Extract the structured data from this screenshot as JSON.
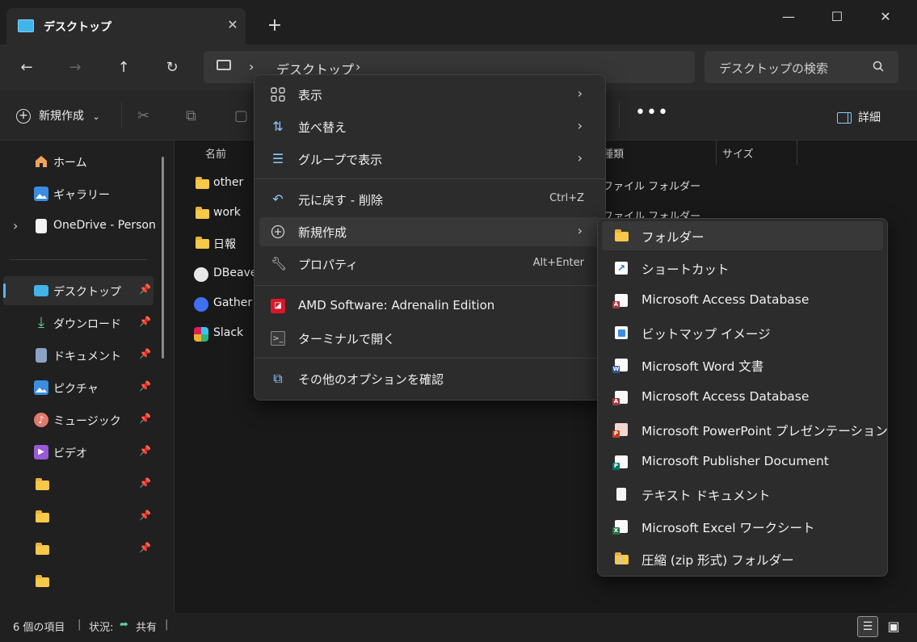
{
  "window": {
    "tab_title": "デスクトップ",
    "tab_close": "✕",
    "new_tab": "+",
    "minimize": "—",
    "maximize": "☐",
    "close": "✕"
  },
  "nav": {
    "back": "←",
    "forward": "→",
    "up": "↑",
    "refresh": "↻",
    "breadcrumb_sep": "›",
    "breadcrumb": "デスクトップ",
    "search_placeholder": "デスクトップの検索"
  },
  "toolbar": {
    "new_label": "新規作成",
    "new_dropdown": "⌄",
    "more": "•••",
    "details_label": "詳細"
  },
  "sidebar": {
    "items": [
      {
        "label": "ホーム",
        "icon": "home-icon",
        "pinned": false
      },
      {
        "label": "ギャラリー",
        "icon": "gallery-icon",
        "pinned": false
      },
      {
        "label": "OneDrive - Persona",
        "icon": "document-icon",
        "pinned": false,
        "expander": "›"
      },
      {
        "label": "デスクトップ",
        "icon": "desktop-icon",
        "pinned": true,
        "selected": true
      },
      {
        "label": "ダウンロード",
        "icon": "download-icon",
        "pinned": true
      },
      {
        "label": "ドキュメント",
        "icon": "documents-icon",
        "pinned": true
      },
      {
        "label": "ピクチャ",
        "icon": "pictures-icon",
        "pinned": true
      },
      {
        "label": "ミュージック",
        "icon": "music-icon",
        "pinned": true
      },
      {
        "label": "ビデオ",
        "icon": "video-icon",
        "pinned": true
      },
      {
        "label": "",
        "icon": "folder-icon",
        "pinned": true
      },
      {
        "label": "",
        "icon": "folder-icon",
        "pinned": true
      },
      {
        "label": "",
        "icon": "folder-icon",
        "pinned": true
      },
      {
        "label": "",
        "icon": "folder-icon",
        "pinned": false
      }
    ]
  },
  "content": {
    "columns": [
      "名前",
      "種類",
      "サイズ"
    ],
    "rows": [
      {
        "name": "other",
        "type": "ファイル フォルダー",
        "icon": "folder-icon"
      },
      {
        "name": "work",
        "type": "ファイル フォルダー",
        "icon": "folder-icon"
      },
      {
        "name": "日報",
        "type": "",
        "icon": "folder-icon"
      },
      {
        "name": "DBeave",
        "type": "",
        "icon": "shortcut-icon"
      },
      {
        "name": "Gather",
        "type": "",
        "icon": "shortcut-icon"
      },
      {
        "name": "Slack",
        "type": "",
        "icon": "slack-icon"
      }
    ]
  },
  "context_menu": {
    "items": [
      {
        "label": "表示",
        "icon": "grid-icon",
        "arrow": "›"
      },
      {
        "label": "並べ替え",
        "icon": "sort-icon",
        "arrow": "›"
      },
      {
        "label": "グループで表示",
        "icon": "group-icon",
        "arrow": "›"
      },
      {
        "label": "元に戻す - 削除",
        "icon": "undo-icon",
        "accel": "Ctrl+Z"
      },
      {
        "label": "新規作成",
        "icon": "new-icon",
        "arrow": "›"
      },
      {
        "label": "プロパティ",
        "icon": "wrench-icon",
        "accel": "Alt+Enter"
      },
      {
        "label": "AMD Software: Adrenalin Edition",
        "icon": "amd-icon"
      },
      {
        "label": "ターミナルで開く",
        "icon": "terminal-icon"
      },
      {
        "label": "その他のオプションを確認",
        "icon": "more-options-icon"
      }
    ]
  },
  "submenu": {
    "items": [
      {
        "label": "フォルダー",
        "icon": "folder-icon"
      },
      {
        "label": "ショートカット",
        "icon": "shortcut-icon"
      },
      {
        "label": "Microsoft Access Database",
        "icon": "access-icon"
      },
      {
        "label": "ビットマップ イメージ",
        "icon": "bitmap-icon"
      },
      {
        "label": "Microsoft Word 文書",
        "icon": "word-icon"
      },
      {
        "label": "Microsoft Access Database",
        "icon": "access-icon"
      },
      {
        "label": "Microsoft PowerPoint プレゼンテーション",
        "icon": "powerpoint-icon"
      },
      {
        "label": "Microsoft Publisher Document",
        "icon": "publisher-icon"
      },
      {
        "label": "テキスト ドキュメント",
        "icon": "text-icon"
      },
      {
        "label": "Microsoft Excel ワークシート",
        "icon": "excel-icon"
      },
      {
        "label": "圧縮 (zip 形式) フォルダー",
        "icon": "zip-icon"
      }
    ]
  },
  "status": {
    "count": "6 個の項目",
    "sep": "|",
    "state_label": "状況:",
    "state_value": "共有"
  },
  "colors": {
    "accent": "#5fb2f2",
    "folder": "#f8c848",
    "menu_bg": "#2c2c2c"
  }
}
